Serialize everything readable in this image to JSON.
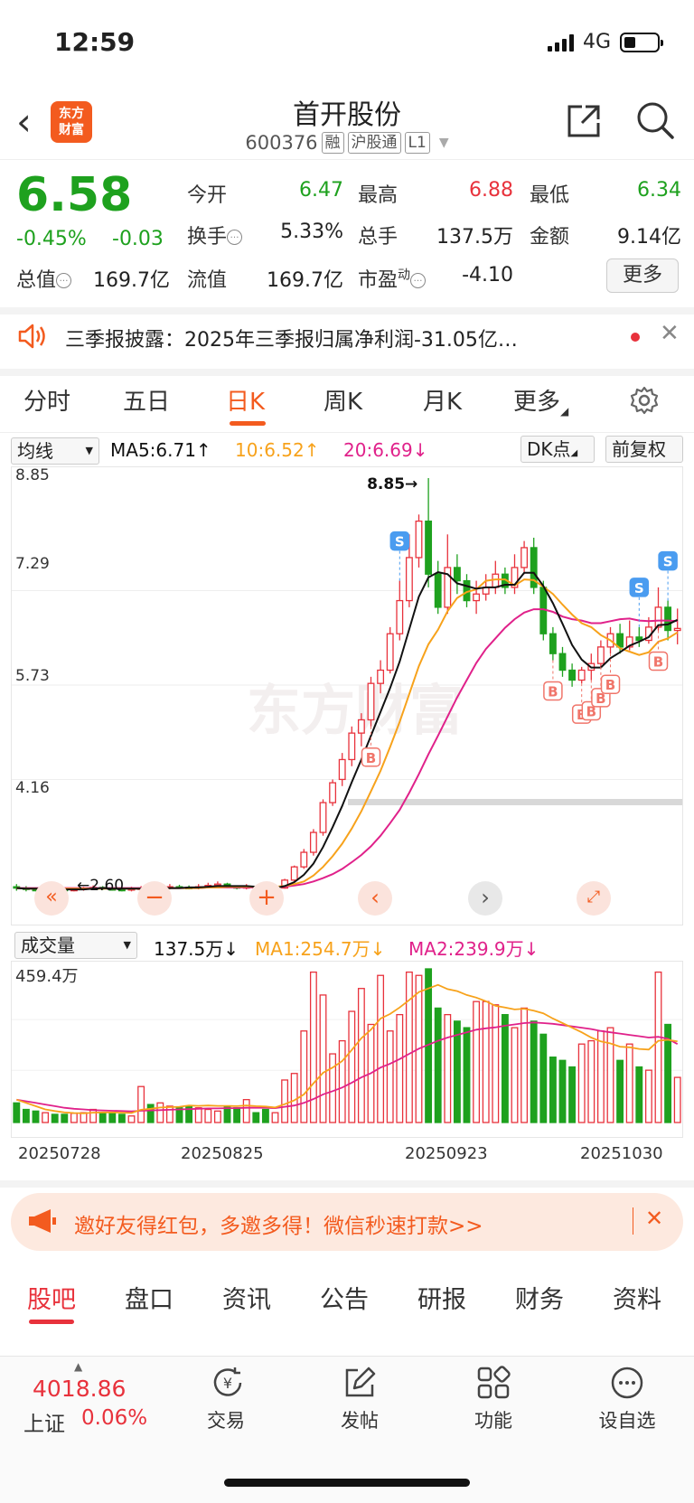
{
  "status": {
    "time": "12:59",
    "network": "4G"
  },
  "header": {
    "logo_line1": "东方",
    "logo_line2": "财富",
    "title": "首开股份",
    "code": "600376",
    "tags": [
      "融",
      "沪股通",
      "L1"
    ]
  },
  "quote": {
    "price": "6.58",
    "change_pct": "-0.45%",
    "change": "-0.03",
    "open_label": "今开",
    "open": "6.47",
    "high_label": "最高",
    "high": "6.88",
    "low_label": "最低",
    "low": "6.34",
    "turnover_label": "换手",
    "turnover": "5.33%",
    "volume_label": "总手",
    "volume": "137.5万",
    "amount_label": "金额",
    "amount": "9.14亿",
    "mktcap_label": "总值",
    "mktcap": "169.7亿",
    "float_label": "流值",
    "float": "169.7亿",
    "pe_label": "市盈",
    "pe_sup": "动",
    "pe": "-4.10",
    "more": "更多"
  },
  "news": {
    "text": "三季报披露：2025年三季报归属净利润-31.05亿…"
  },
  "tabs": [
    "分时",
    "五日",
    "日K",
    "周K",
    "月K",
    "更多"
  ],
  "chart_toolbar": {
    "indicator": "均线",
    "ma5": "MA5:6.71↑",
    "ma10": "10:6.52↑",
    "ma20": "20:6.69↓",
    "dk": "DK点",
    "adjust": "前复权",
    "vol_indicator": "成交量",
    "vol_value": "137.5万↓",
    "vol_ma1": "MA1:254.7万↓",
    "vol_ma2": "MA2:239.9万↓"
  },
  "colors": {
    "up": "#e8323c",
    "down": "#1ea11e",
    "ma5": "#111111",
    "ma10": "#f7a21b",
    "ma20": "#e0218a",
    "accent": "#f35b1f"
  },
  "chart_data": {
    "type": "candlestick",
    "price_axis": [
      "8.85",
      "7.29",
      "5.73",
      "4.16"
    ],
    "low_label": "2.60",
    "high_label": "8.85",
    "ylim": [
      2.6,
      8.85
    ],
    "vol_axis_max": "459.4万",
    "x_labels": [
      "20250728",
      "20250825",
      "20250923",
      "20251030"
    ],
    "candles": [
      [
        2.68,
        2.66,
        2.72,
        2.62
      ],
      [
        2.66,
        2.64,
        2.69,
        2.61
      ],
      [
        2.64,
        2.63,
        2.67,
        2.61
      ],
      [
        2.63,
        2.65,
        2.68,
        2.61
      ],
      [
        2.65,
        2.64,
        2.67,
        2.62
      ],
      [
        2.64,
        2.62,
        2.66,
        2.6
      ],
      [
        2.62,
        2.64,
        2.66,
        2.61
      ],
      [
        2.64,
        2.66,
        2.68,
        2.62
      ],
      [
        2.66,
        2.67,
        2.7,
        2.63
      ],
      [
        2.67,
        2.65,
        2.69,
        2.63
      ],
      [
        2.65,
        2.64,
        2.68,
        2.62
      ],
      [
        2.64,
        2.63,
        2.66,
        2.61
      ],
      [
        2.63,
        2.65,
        2.68,
        2.61
      ],
      [
        2.65,
        2.66,
        2.69,
        2.63
      ],
      [
        2.66,
        2.65,
        2.7,
        2.63
      ],
      [
        2.65,
        2.66,
        2.72,
        2.63
      ],
      [
        2.66,
        2.68,
        2.72,
        2.64
      ],
      [
        2.68,
        2.67,
        2.71,
        2.65
      ],
      [
        2.67,
        2.66,
        2.7,
        2.64
      ],
      [
        2.66,
        2.68,
        2.72,
        2.64
      ],
      [
        2.68,
        2.7,
        2.74,
        2.66
      ],
      [
        2.7,
        2.72,
        2.76,
        2.67
      ],
      [
        2.72,
        2.68,
        2.74,
        2.66
      ],
      [
        2.68,
        2.66,
        2.7,
        2.64
      ],
      [
        2.66,
        2.68,
        2.72,
        2.64
      ],
      [
        2.68,
        2.66,
        2.7,
        2.64
      ],
      [
        2.66,
        2.65,
        2.68,
        2.63
      ],
      [
        2.65,
        2.66,
        2.69,
        2.63
      ],
      [
        2.66,
        2.78,
        2.8,
        2.65
      ],
      [
        2.78,
        2.98,
        3.0,
        2.76
      ],
      [
        2.98,
        3.2,
        3.25,
        2.95
      ],
      [
        3.2,
        3.5,
        3.55,
        3.15
      ],
      [
        3.5,
        3.95,
        4.0,
        3.45
      ],
      [
        3.95,
        4.25,
        4.3,
        3.9
      ],
      [
        4.3,
        4.6,
        4.7,
        4.2
      ],
      [
        4.6,
        5.0,
        5.1,
        4.5
      ],
      [
        5.0,
        5.2,
        5.3,
        4.8
      ],
      [
        5.2,
        5.75,
        5.85,
        5.1
      ],
      [
        5.75,
        5.95,
        6.1,
        5.6
      ],
      [
        5.95,
        6.5,
        6.6,
        5.9
      ],
      [
        6.5,
        7.0,
        7.3,
        6.4
      ],
      [
        7.0,
        7.65,
        8.0,
        6.9
      ],
      [
        7.65,
        8.2,
        8.3,
        7.5
      ],
      [
        8.2,
        7.4,
        8.85,
        7.2
      ],
      [
        7.4,
        6.9,
        7.6,
        6.8
      ],
      [
        6.9,
        7.5,
        8.0,
        6.8
      ],
      [
        7.5,
        7.3,
        7.7,
        7.1
      ],
      [
        7.3,
        7.0,
        7.4,
        6.9
      ],
      [
        7.0,
        7.1,
        7.3,
        6.8
      ],
      [
        7.1,
        7.2,
        7.4,
        7.0
      ],
      [
        7.2,
        7.4,
        7.6,
        7.1
      ],
      [
        7.4,
        7.2,
        7.5,
        7.1
      ],
      [
        7.2,
        7.5,
        7.7,
        7.1
      ],
      [
        7.5,
        7.8,
        7.9,
        7.4
      ],
      [
        7.8,
        7.2,
        7.95,
        7.1
      ],
      [
        7.2,
        6.5,
        7.3,
        6.4
      ],
      [
        6.5,
        6.2,
        6.6,
        6.1
      ],
      [
        6.2,
        5.95,
        6.3,
        5.85
      ],
      [
        5.95,
        5.8,
        6.05,
        5.7
      ],
      [
        5.8,
        5.95,
        6.0,
        5.75
      ],
      [
        5.95,
        6.05,
        6.2,
        5.8
      ],
      [
        6.05,
        6.3,
        6.4,
        6.0
      ],
      [
        6.3,
        6.5,
        6.6,
        6.2
      ],
      [
        6.5,
        6.3,
        6.65,
        6.2
      ],
      [
        6.3,
        6.45,
        6.7,
        6.25
      ],
      [
        6.45,
        6.4,
        6.6,
        6.3
      ],
      [
        6.4,
        6.6,
        6.75,
        6.35
      ],
      [
        6.6,
        6.9,
        7.2,
        6.55
      ],
      [
        6.9,
        6.55,
        7.0,
        6.4
      ],
      [
        6.55,
        6.58,
        6.88,
        6.34
      ]
    ],
    "volumes": [
      0.6,
      0.4,
      0.35,
      0.3,
      0.25,
      0.25,
      0.28,
      0.3,
      0.4,
      0.3,
      0.3,
      0.25,
      0.2,
      1.1,
      0.55,
      0.6,
      0.5,
      0.45,
      0.5,
      0.45,
      0.4,
      0.35,
      0.5,
      0.45,
      0.7,
      0.3,
      0.4,
      0.3,
      1.3,
      1.5,
      2.8,
      4.6,
      3.9,
      2.1,
      2.5,
      3.4,
      4.1,
      3.0,
      4.5,
      2.8,
      3.3,
      4.6,
      4.5,
      4.7,
      3.5,
      3.3,
      3.1,
      2.9,
      3.7,
      3.7,
      3.6,
      3.3,
      2.9,
      3.5,
      3.1,
      2.7,
      2.0,
      1.9,
      1.7,
      2.4,
      2.5,
      2.8,
      2.9,
      1.9,
      2.4,
      1.7,
      1.6,
      4.6,
      3.0,
      1.38
    ],
    "ma5": [
      2.66,
      2.65,
      2.65,
      2.65,
      2.64,
      2.64,
      2.64,
      2.64,
      2.65,
      2.66,
      2.65,
      2.65,
      2.65,
      2.65,
      2.65,
      2.66,
      2.66,
      2.66,
      2.67,
      2.67,
      2.68,
      2.69,
      2.69,
      2.69,
      2.69,
      2.68,
      2.67,
      2.66,
      2.69,
      2.75,
      2.86,
      3.03,
      3.28,
      3.58,
      3.9,
      4.26,
      4.6,
      4.96,
      5.32,
      5.68,
      6.08,
      6.57,
      7.06,
      7.35,
      7.43,
      7.4,
      7.26,
      7.22,
      7.18,
      7.2,
      7.2,
      7.24,
      7.24,
      7.42,
      7.42,
      7.22,
      6.96,
      6.65,
      6.33,
      6.11,
      5.99,
      5.99,
      6.13,
      6.22,
      6.32,
      6.38,
      6.45,
      6.63,
      6.64,
      6.71
    ],
    "ma10": [
      2.66,
      2.65,
      2.65,
      2.65,
      2.65,
      2.65,
      2.65,
      2.65,
      2.65,
      2.65,
      2.65,
      2.65,
      2.65,
      2.65,
      2.65,
      2.65,
      2.66,
      2.66,
      2.66,
      2.66,
      2.67,
      2.67,
      2.68,
      2.68,
      2.68,
      2.68,
      2.68,
      2.68,
      2.69,
      2.72,
      2.76,
      2.85,
      2.98,
      3.14,
      3.33,
      3.56,
      3.82,
      4.12,
      4.43,
      4.79,
      5.17,
      5.59,
      6.01,
      6.34,
      6.56,
      6.84,
      7.04,
      7.13,
      7.17,
      7.3,
      7.32,
      7.32,
      7.23,
      7.32,
      7.31,
      7.21,
      7.1,
      6.94,
      6.79,
      6.66,
      6.6,
      6.48,
      6.4,
      6.28,
      6.23,
      6.18,
      6.22,
      6.38,
      6.43,
      6.52
    ],
    "ma20": [
      2.66,
      2.66,
      2.66,
      2.66,
      2.66,
      2.66,
      2.66,
      2.66,
      2.66,
      2.66,
      2.66,
      2.66,
      2.66,
      2.66,
      2.66,
      2.66,
      2.66,
      2.66,
      2.66,
      2.66,
      2.67,
      2.67,
      2.67,
      2.67,
      2.67,
      2.67,
      2.67,
      2.68,
      2.68,
      2.7,
      2.72,
      2.76,
      2.81,
      2.87,
      2.95,
      3.05,
      3.16,
      3.29,
      3.45,
      3.64,
      3.84,
      4.1,
      4.38,
      4.68,
      4.96,
      5.25,
      5.54,
      5.8,
      6.06,
      6.27,
      6.43,
      6.59,
      6.72,
      6.82,
      6.87,
      6.87,
      6.83,
      6.76,
      6.72,
      6.7,
      6.66,
      6.66,
      6.69,
      6.72,
      6.73,
      6.7,
      6.69,
      6.7,
      6.7,
      6.69
    ],
    "vma1": [
      0.7,
      0.6,
      0.5,
      0.4,
      0.35,
      0.31,
      0.29,
      0.28,
      0.3,
      0.31,
      0.31,
      0.3,
      0.29,
      0.39,
      0.42,
      0.46,
      0.47,
      0.48,
      0.52,
      0.51,
      0.52,
      0.51,
      0.51,
      0.5,
      0.52,
      0.5,
      0.49,
      0.46,
      0.56,
      0.68,
      0.86,
      1.2,
      1.52,
      1.68,
      1.88,
      2.22,
      2.58,
      2.84,
      3.18,
      3.32,
      3.52,
      3.75,
      3.99,
      4.1,
      4.21,
      4.08,
      4.02,
      3.9,
      3.82,
      3.71,
      3.57,
      3.52,
      3.46,
      3.48,
      3.42,
      3.34,
      3.18,
      3.04,
      2.9,
      2.76,
      2.6,
      2.48,
      2.42,
      2.32,
      2.3,
      2.25,
      2.23,
      2.5,
      2.53,
      2.48
    ],
    "vma2": [
      0.7,
      0.65,
      0.6,
      0.55,
      0.5,
      0.45,
      0.42,
      0.4,
      0.38,
      0.37,
      0.36,
      0.35,
      0.34,
      0.36,
      0.37,
      0.38,
      0.39,
      0.4,
      0.41,
      0.42,
      0.43,
      0.43,
      0.44,
      0.44,
      0.45,
      0.45,
      0.45,
      0.44,
      0.48,
      0.52,
      0.6,
      0.72,
      0.86,
      0.96,
      1.07,
      1.22,
      1.38,
      1.51,
      1.68,
      1.8,
      1.94,
      2.1,
      2.26,
      2.38,
      2.5,
      2.6,
      2.68,
      2.76,
      2.84,
      2.88,
      2.91,
      2.96,
      3.0,
      3.04,
      3.06,
      3.04,
      3.02,
      2.98,
      2.94,
      2.9,
      2.86,
      2.8,
      2.76,
      2.72,
      2.68,
      2.64,
      2.6,
      2.62,
      2.56,
      2.4
    ],
    "signals": [
      {
        "type": "B",
        "i": 37
      },
      {
        "type": "S",
        "i": 40
      },
      {
        "type": "B",
        "i": 56
      },
      {
        "type": "B",
        "i": 59
      },
      {
        "type": "B",
        "i": 60
      },
      {
        "type": "B",
        "i": 61
      },
      {
        "type": "B",
        "i": 62
      },
      {
        "type": "S",
        "i": 65
      },
      {
        "type": "S",
        "i": 68
      },
      {
        "type": "B",
        "i": 67
      }
    ]
  },
  "invite": {
    "text": "邀好友得红包，多邀多得！微信秒速打款>>"
  },
  "bottom_tabs": [
    "股吧",
    "盘口",
    "资讯",
    "公告",
    "研报",
    "财务",
    "资料"
  ],
  "footer": {
    "index_value": "4018.86",
    "index_name": "上证",
    "index_pct": "0.06%",
    "items": [
      "交易",
      "发帖",
      "功能",
      "设自选"
    ]
  }
}
